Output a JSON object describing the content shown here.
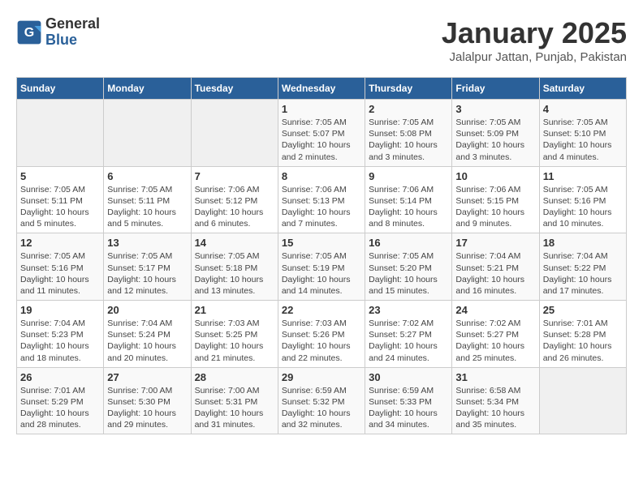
{
  "header": {
    "logo_general": "General",
    "logo_blue": "Blue",
    "title": "January 2025",
    "subtitle": "Jalalpur Jattan, Punjab, Pakistan"
  },
  "weekdays": [
    "Sunday",
    "Monday",
    "Tuesday",
    "Wednesday",
    "Thursday",
    "Friday",
    "Saturday"
  ],
  "weeks": [
    [
      {
        "day": "",
        "info": ""
      },
      {
        "day": "",
        "info": ""
      },
      {
        "day": "",
        "info": ""
      },
      {
        "day": "1",
        "info": "Sunrise: 7:05 AM\nSunset: 5:07 PM\nDaylight: 10 hours\nand 2 minutes."
      },
      {
        "day": "2",
        "info": "Sunrise: 7:05 AM\nSunset: 5:08 PM\nDaylight: 10 hours\nand 3 minutes."
      },
      {
        "day": "3",
        "info": "Sunrise: 7:05 AM\nSunset: 5:09 PM\nDaylight: 10 hours\nand 3 minutes."
      },
      {
        "day": "4",
        "info": "Sunrise: 7:05 AM\nSunset: 5:10 PM\nDaylight: 10 hours\nand 4 minutes."
      }
    ],
    [
      {
        "day": "5",
        "info": "Sunrise: 7:05 AM\nSunset: 5:11 PM\nDaylight: 10 hours\nand 5 minutes."
      },
      {
        "day": "6",
        "info": "Sunrise: 7:05 AM\nSunset: 5:11 PM\nDaylight: 10 hours\nand 5 minutes."
      },
      {
        "day": "7",
        "info": "Sunrise: 7:06 AM\nSunset: 5:12 PM\nDaylight: 10 hours\nand 6 minutes."
      },
      {
        "day": "8",
        "info": "Sunrise: 7:06 AM\nSunset: 5:13 PM\nDaylight: 10 hours\nand 7 minutes."
      },
      {
        "day": "9",
        "info": "Sunrise: 7:06 AM\nSunset: 5:14 PM\nDaylight: 10 hours\nand 8 minutes."
      },
      {
        "day": "10",
        "info": "Sunrise: 7:06 AM\nSunset: 5:15 PM\nDaylight: 10 hours\nand 9 minutes."
      },
      {
        "day": "11",
        "info": "Sunrise: 7:05 AM\nSunset: 5:16 PM\nDaylight: 10 hours\nand 10 minutes."
      }
    ],
    [
      {
        "day": "12",
        "info": "Sunrise: 7:05 AM\nSunset: 5:16 PM\nDaylight: 10 hours\nand 11 minutes."
      },
      {
        "day": "13",
        "info": "Sunrise: 7:05 AM\nSunset: 5:17 PM\nDaylight: 10 hours\nand 12 minutes."
      },
      {
        "day": "14",
        "info": "Sunrise: 7:05 AM\nSunset: 5:18 PM\nDaylight: 10 hours\nand 13 minutes."
      },
      {
        "day": "15",
        "info": "Sunrise: 7:05 AM\nSunset: 5:19 PM\nDaylight: 10 hours\nand 14 minutes."
      },
      {
        "day": "16",
        "info": "Sunrise: 7:05 AM\nSunset: 5:20 PM\nDaylight: 10 hours\nand 15 minutes."
      },
      {
        "day": "17",
        "info": "Sunrise: 7:04 AM\nSunset: 5:21 PM\nDaylight: 10 hours\nand 16 minutes."
      },
      {
        "day": "18",
        "info": "Sunrise: 7:04 AM\nSunset: 5:22 PM\nDaylight: 10 hours\nand 17 minutes."
      }
    ],
    [
      {
        "day": "19",
        "info": "Sunrise: 7:04 AM\nSunset: 5:23 PM\nDaylight: 10 hours\nand 18 minutes."
      },
      {
        "day": "20",
        "info": "Sunrise: 7:04 AM\nSunset: 5:24 PM\nDaylight: 10 hours\nand 20 minutes."
      },
      {
        "day": "21",
        "info": "Sunrise: 7:03 AM\nSunset: 5:25 PM\nDaylight: 10 hours\nand 21 minutes."
      },
      {
        "day": "22",
        "info": "Sunrise: 7:03 AM\nSunset: 5:26 PM\nDaylight: 10 hours\nand 22 minutes."
      },
      {
        "day": "23",
        "info": "Sunrise: 7:02 AM\nSunset: 5:27 PM\nDaylight: 10 hours\nand 24 minutes."
      },
      {
        "day": "24",
        "info": "Sunrise: 7:02 AM\nSunset: 5:27 PM\nDaylight: 10 hours\nand 25 minutes."
      },
      {
        "day": "25",
        "info": "Sunrise: 7:01 AM\nSunset: 5:28 PM\nDaylight: 10 hours\nand 26 minutes."
      }
    ],
    [
      {
        "day": "26",
        "info": "Sunrise: 7:01 AM\nSunset: 5:29 PM\nDaylight: 10 hours\nand 28 minutes."
      },
      {
        "day": "27",
        "info": "Sunrise: 7:00 AM\nSunset: 5:30 PM\nDaylight: 10 hours\nand 29 minutes."
      },
      {
        "day": "28",
        "info": "Sunrise: 7:00 AM\nSunset: 5:31 PM\nDaylight: 10 hours\nand 31 minutes."
      },
      {
        "day": "29",
        "info": "Sunrise: 6:59 AM\nSunset: 5:32 PM\nDaylight: 10 hours\nand 32 minutes."
      },
      {
        "day": "30",
        "info": "Sunrise: 6:59 AM\nSunset: 5:33 PM\nDaylight: 10 hours\nand 34 minutes."
      },
      {
        "day": "31",
        "info": "Sunrise: 6:58 AM\nSunset: 5:34 PM\nDaylight: 10 hours\nand 35 minutes."
      },
      {
        "day": "",
        "info": ""
      }
    ]
  ]
}
